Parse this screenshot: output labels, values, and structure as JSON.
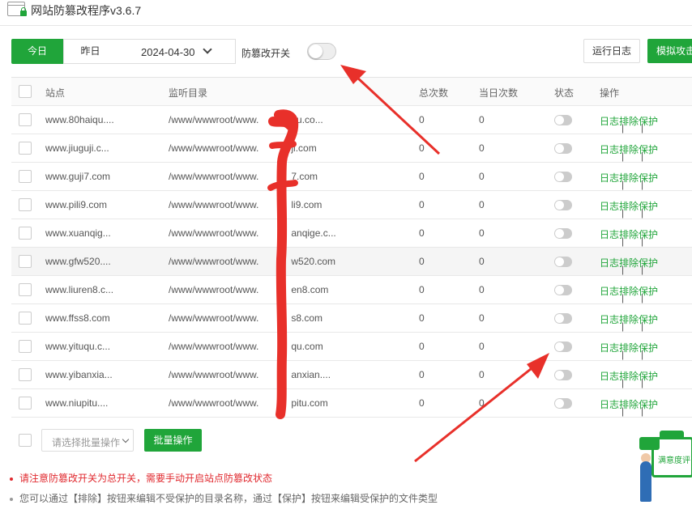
{
  "app": {
    "title": "网站防篡改程序v3.6.7"
  },
  "toolbar": {
    "today": "今日",
    "yesterday": "昨日",
    "date": "2024-04-30",
    "switch_label": "防篡改开关",
    "log_button": "运行日志",
    "attack_button": "模拟攻击"
  },
  "table": {
    "headers": {
      "site": "站点",
      "dir": "监听目录",
      "total": "总次数",
      "today": "当日次数",
      "status": "状态",
      "ops": "操作"
    },
    "ops": {
      "log": "日志",
      "exclude": "排除",
      "protect": "保护"
    },
    "rows": [
      {
        "site": "www.80haiqu....",
        "dir_prefix": "/www/wwwroot/www.",
        "dir_suffix": "qu.co...",
        "total": "0",
        "today": "0"
      },
      {
        "site": "www.jiuguji.c...",
        "dir_prefix": "/www/wwwroot/www.",
        "dir_suffix": "ji.com",
        "total": "0",
        "today": "0"
      },
      {
        "site": "www.guji7.com",
        "dir_prefix": "/www/wwwroot/www.",
        "dir_suffix": "7.com",
        "total": "0",
        "today": "0"
      },
      {
        "site": "www.pili9.com",
        "dir_prefix": "/www/wwwroot/www.",
        "dir_suffix": "li9.com",
        "total": "0",
        "today": "0"
      },
      {
        "site": "www.xuanqig...",
        "dir_prefix": "/www/wwwroot/www.",
        "dir_suffix": "anqige.c...",
        "total": "0",
        "today": "0"
      },
      {
        "site": "www.gfw520....",
        "dir_prefix": "/www/wwwroot/www.",
        "dir_suffix": "w520.com",
        "total": "0",
        "today": "0"
      },
      {
        "site": "www.liuren8.c...",
        "dir_prefix": "/www/wwwroot/www.",
        "dir_suffix": "en8.com",
        "total": "0",
        "today": "0"
      },
      {
        "site": "www.ffss8.com",
        "dir_prefix": "/www/wwwroot/www.",
        "dir_suffix": "s8.com",
        "total": "0",
        "today": "0"
      },
      {
        "site": "www.yituqu.c...",
        "dir_prefix": "/www/wwwroot/www.",
        "dir_suffix": "qu.com",
        "total": "0",
        "today": "0"
      },
      {
        "site": "www.yibanxia...",
        "dir_prefix": "/www/wwwroot/www.",
        "dir_suffix": "anxian....",
        "total": "0",
        "today": "0"
      },
      {
        "site": "www.niupitu....",
        "dir_prefix": "/www/wwwroot/www.",
        "dir_suffix": "pitu.com",
        "total": "0",
        "today": "0"
      }
    ]
  },
  "batch": {
    "placeholder": "请选择批量操作",
    "button": "批量操作"
  },
  "notes": [
    "请注意防篡改开关为总开关，需要手动开启站点防篡改状态",
    "您可以通过【排除】按钮来编辑不受保护的目录名称，通过【保护】按钮来编辑受保护的文件类型"
  ],
  "rating": {
    "label": "满意度评"
  },
  "colors": {
    "accent": "#20a53a",
    "warning": "#e0282e",
    "annotation": "#e8302a"
  },
  "icons": [
    "app-window-icon",
    "lock-icon",
    "chevron-down-icon"
  ]
}
